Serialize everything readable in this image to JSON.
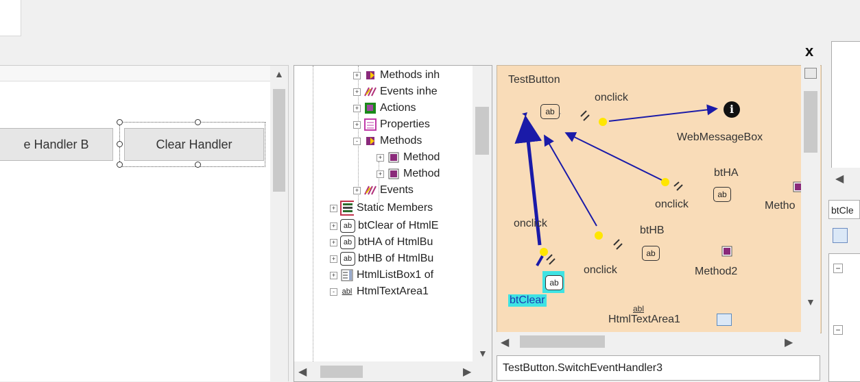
{
  "window": {
    "close_label": "x"
  },
  "designer": {
    "button_b_label": "e Handler B",
    "button_clear_label": "Clear Handler"
  },
  "tree": {
    "items": [
      {
        "label": "Methods inh",
        "icon": "method-icon",
        "expander": "+"
      },
      {
        "label": "Events inhe",
        "icon": "events-icon",
        "expander": "+"
      },
      {
        "label": "Actions",
        "icon": "actions-icon",
        "expander": "+"
      },
      {
        "label": "Properties",
        "icon": "properties-icon",
        "expander": "+"
      },
      {
        "label": "Methods",
        "icon": "method-icon",
        "expander": "-"
      },
      {
        "label": "Method",
        "icon": "method-item-icon",
        "expander": "+"
      },
      {
        "label": "Method",
        "icon": "method-item-icon",
        "expander": "+"
      },
      {
        "label": "Events",
        "icon": "events-icon",
        "expander": "+"
      },
      {
        "label": "Static Members",
        "icon": "static-members-icon",
        "expander": "+"
      },
      {
        "label": "btClear of HtmlE",
        "icon": "ab-icon",
        "expander": "+"
      },
      {
        "label": "btHA of HtmlBu",
        "icon": "ab-icon",
        "expander": "+"
      },
      {
        "label": "btHB of HtmlBu",
        "icon": "ab-icon",
        "expander": "+"
      },
      {
        "label": "HtmlListBox1 of",
        "icon": "listbox-icon",
        "expander": "+"
      },
      {
        "label": "HtmlTextArea1",
        "icon": "textarea-icon",
        "expander": "-"
      }
    ]
  },
  "graph": {
    "labels": {
      "test_button": "TestButton",
      "onclick_top": "onclick",
      "web_message_box": "WebMessageBox",
      "bt_ha": "btHA",
      "onclick_ha": "onclick",
      "method_partial": "Metho",
      "onclick_left": "onclick",
      "bt_hb": "btHB",
      "onclick_hb": "onclick",
      "method2": "Method2",
      "bt_clear": "btClear",
      "html_text_area": "HtmlTextArea1",
      "ab_glyph": "ab",
      "abl_glyph": "abl",
      "info_glyph": "i"
    }
  },
  "status": {
    "text": "TestButton.SwitchEventHandler3"
  },
  "right_panel": {
    "name_partial": "btCle"
  },
  "colors": {
    "graph_bg": "#f9dcb8",
    "link": "#1a1aa8",
    "highlight": "#3fe3e3",
    "node_yellow": "#ffe600"
  }
}
